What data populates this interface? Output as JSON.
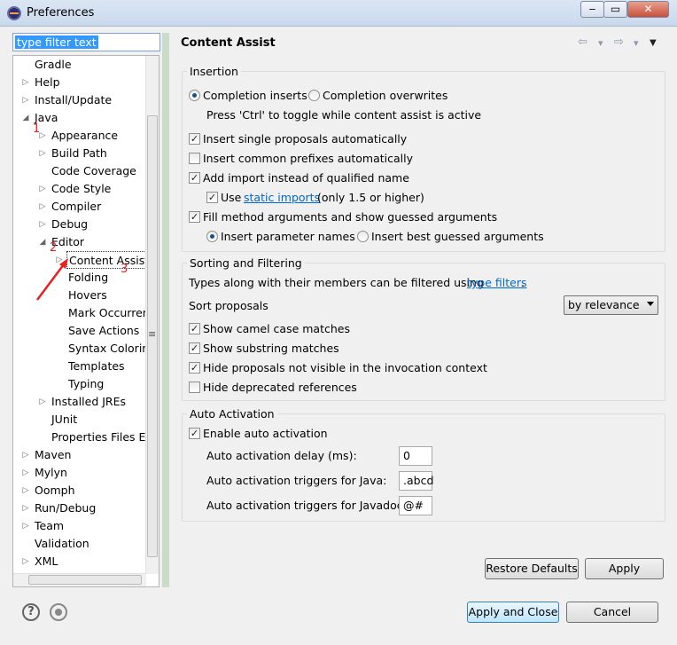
{
  "window": {
    "title": "Preferences",
    "min": "‒",
    "max": "▭",
    "close": "✕"
  },
  "filter": {
    "value": "type filter text"
  },
  "tree": {
    "items": [
      {
        "label": "Gradle",
        "twisty": ""
      },
      {
        "label": "Help",
        "twisty": "▷"
      },
      {
        "label": "Install/Update",
        "twisty": "▷"
      },
      {
        "label": "Java",
        "twisty": "◢"
      },
      {
        "label": "Appearance",
        "twisty": "▷"
      },
      {
        "label": "Build Path",
        "twisty": "▷"
      },
      {
        "label": "Code Coverage",
        "twisty": ""
      },
      {
        "label": "Code Style",
        "twisty": "▷"
      },
      {
        "label": "Compiler",
        "twisty": "▷"
      },
      {
        "label": "Debug",
        "twisty": "▷"
      },
      {
        "label": "Editor",
        "twisty": "◢"
      },
      {
        "label": "Content Assist",
        "twisty": "▷"
      },
      {
        "label": "Folding",
        "twisty": ""
      },
      {
        "label": "Hovers",
        "twisty": ""
      },
      {
        "label": "Mark Occurren",
        "twisty": ""
      },
      {
        "label": "Save Actions",
        "twisty": ""
      },
      {
        "label": "Syntax Coloring",
        "twisty": ""
      },
      {
        "label": "Templates",
        "twisty": ""
      },
      {
        "label": "Typing",
        "twisty": ""
      },
      {
        "label": "Installed JREs",
        "twisty": "▷"
      },
      {
        "label": "JUnit",
        "twisty": ""
      },
      {
        "label": "Properties Files Ed",
        "twisty": ""
      },
      {
        "label": "Maven",
        "twisty": "▷"
      },
      {
        "label": "Mylyn",
        "twisty": "▷"
      },
      {
        "label": "Oomph",
        "twisty": "▷"
      },
      {
        "label": "Run/Debug",
        "twisty": "▷"
      },
      {
        "label": "Team",
        "twisty": "▷"
      },
      {
        "label": "Validation",
        "twisty": ""
      },
      {
        "label": "XML",
        "twisty": "▷"
      }
    ],
    "scroll_grip": "≡"
  },
  "annotations": {
    "n1": "1",
    "n2": "2",
    "n3": "3"
  },
  "page": {
    "title": "Content Assist",
    "back": "⇦",
    "back_menu": "▾",
    "fwd": "⇨",
    "fwd_menu": "▾",
    "menu": "▼"
  },
  "insertion": {
    "label": "Insertion",
    "completion_inserts": "Completion inserts",
    "completion_overwrites": "Completion overwrites",
    "hint": "Press 'Ctrl' to toggle while content assist is active",
    "insert_single": "Insert single proposals automatically",
    "insert_prefixes": "Insert common prefixes automatically",
    "add_import": "Add import instead of qualified name",
    "use_label": "Use",
    "static_imports": "static imports",
    "only_label": "(only 1.5 or higher)",
    "fill_args": "Fill method arguments and show guessed arguments",
    "insert_param_names": "Insert parameter names",
    "insert_best": "Insert best guessed arguments",
    "check": "✓"
  },
  "sorting": {
    "label": "Sorting and Filtering",
    "types_text": "Types along with their members can be filtered using",
    "type_filters": "type filters",
    "period": ".",
    "sort_label": "Sort proposals",
    "sort_value": "by relevance",
    "camel": "Show camel case matches",
    "substring": "Show substring matches",
    "hide_not_visible": "Hide proposals not visible in the invocation context",
    "hide_deprecated": "Hide deprecated references"
  },
  "auto": {
    "label": "Auto Activation",
    "enable": "Enable auto activation",
    "delay_label": "Auto activation delay (ms):",
    "delay_value": "0",
    "java_label": "Auto activation triggers for Java:",
    "java_value": ".abcd",
    "javadoc_label": "Auto activation triggers for Javadoc:",
    "javadoc_value": "@#"
  },
  "buttons": {
    "restore": "Restore Defaults",
    "apply": "Apply",
    "apply_close": "Apply and Close",
    "cancel": "Cancel"
  },
  "footer": {
    "help": "?"
  },
  "colors": {
    "accent": "#3399ff",
    "link": "#0066cc",
    "annotation": "#e82020"
  }
}
